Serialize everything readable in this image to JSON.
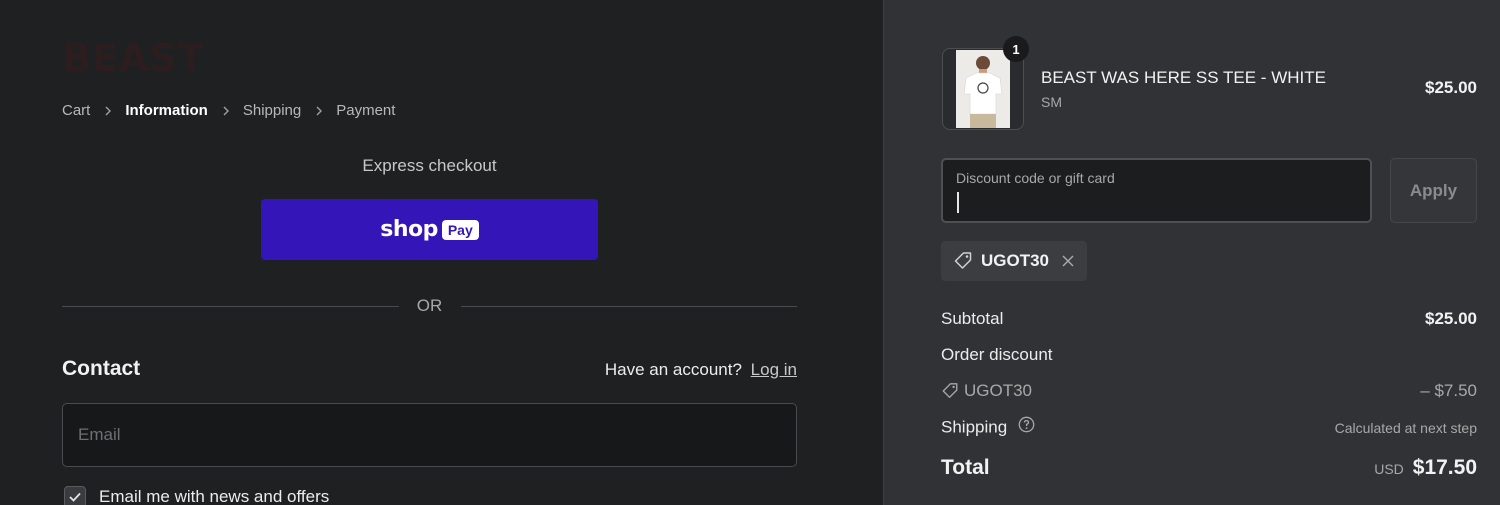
{
  "brand": {
    "logo_text": "BEAST"
  },
  "breadcrumb": [
    "Cart",
    "Information",
    "Shipping",
    "Payment"
  ],
  "express": {
    "title": "Express checkout",
    "shop_word": "shop",
    "pay_badge": "Pay",
    "or_text": "OR"
  },
  "contact": {
    "title": "Contact",
    "account_prompt": "Have an account?",
    "login_link": "Log in",
    "email_placeholder": "Email",
    "newsletter_label": "Email me with news and offers",
    "newsletter_checked": true
  },
  "order": {
    "item_name": "BEAST WAS HERE SS TEE - WHITE",
    "item_variant": "SM",
    "item_price": "$25.00",
    "quantity": "1",
    "discount_placeholder": "Discount code or gift card",
    "apply_label": "Apply",
    "applied_code": "UGOT30",
    "subtotal_label": "Subtotal",
    "subtotal_value": "$25.00",
    "order_discount_label": "Order discount",
    "discount_code": "UGOT30",
    "discount_value": "– $7.50",
    "shipping_label": "Shipping",
    "shipping_value": "Calculated at next step",
    "total_label": "Total",
    "currency": "USD",
    "total_value": "$17.50"
  },
  "colors": {
    "left_bg": "#1f2022",
    "right_bg": "#303236",
    "shop_pay": "#3416b8"
  }
}
